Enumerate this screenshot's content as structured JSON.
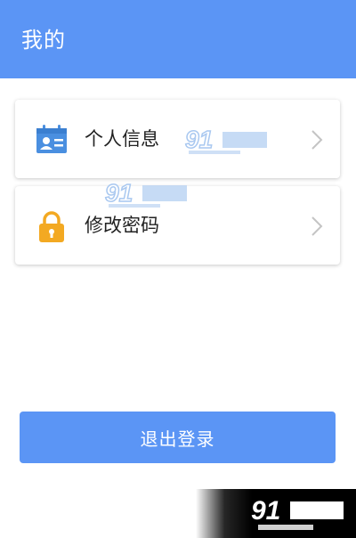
{
  "header": {
    "title": "我的"
  },
  "menu": [
    {
      "label": "个人信息",
      "icon": "id-card-icon"
    },
    {
      "label": "修改密码",
      "icon": "lock-icon"
    }
  ],
  "logout": {
    "label": "退出登录"
  },
  "colors": {
    "accent": "#5b95f5",
    "icon_blue": "#4a8fe0",
    "icon_orange": "#f3a922"
  }
}
